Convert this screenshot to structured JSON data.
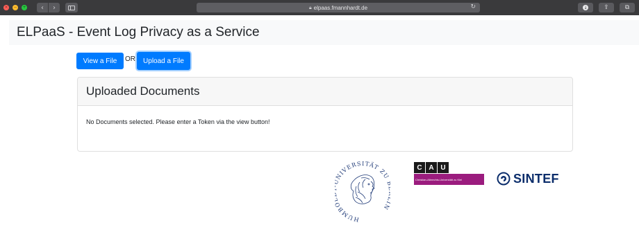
{
  "browser": {
    "url": "elpaas.fmannhardt.de",
    "icons": [
      "close-dot",
      "minimize-dot",
      "maximize-dot",
      "back-arrow-icon",
      "forward-arrow-icon",
      "sidebar-icon",
      "lock-icon",
      "reload-icon",
      "download-icon",
      "share-icon",
      "tabs-icon"
    ],
    "traffic_colors": {
      "close": "#ff5f57",
      "minimize": "#febc2e",
      "maximize": "#28c840"
    }
  },
  "header": {
    "title": "ELPaaS - Event Log Privacy as a Service"
  },
  "actions": {
    "view_label": "View a File",
    "separator": "OR",
    "upload_label": "Upload a File"
  },
  "card": {
    "title": "Uploaded Documents",
    "message": "No Documents selected. Please enter a Token via the view button!"
  },
  "logos": {
    "humboldt": {
      "ring_text": "HUMBOLDT-UNIVERSITÄT ZU BERLIN"
    },
    "cau": {
      "letters": [
        "C",
        "A",
        "U"
      ],
      "subtitle": "Christian-Albrechts-Universität zu Kiel",
      "color": "#9b1c7e"
    },
    "sintef": {
      "name": "SINTEF",
      "color": "#0b2d6b"
    }
  },
  "colors": {
    "primary": "#007bff",
    "header_bg": "#f8f9fa",
    "chrome_bg": "#3a3a3c"
  }
}
